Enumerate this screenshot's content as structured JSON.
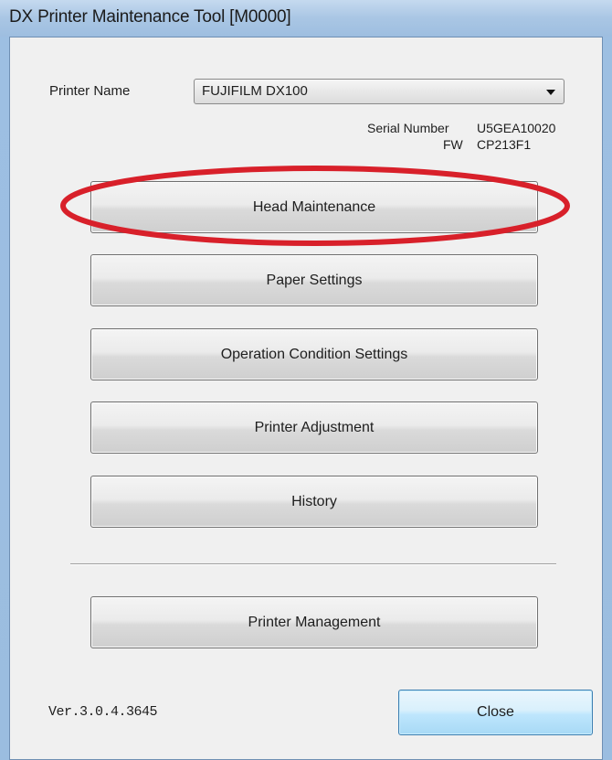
{
  "window": {
    "title": "DX Printer Maintenance Tool [M0000]"
  },
  "printer": {
    "name_label": "Printer Name",
    "selected": "FUJIFILM DX100",
    "serial_label": "Serial Number",
    "serial_value": "U5GEA10020",
    "fw_label": "FW",
    "fw_value": "CP213F1"
  },
  "buttons": {
    "head_maintenance": "Head Maintenance",
    "paper_settings": "Paper Settings",
    "operation_condition_settings": "Operation Condition Settings",
    "printer_adjustment": "Printer Adjustment",
    "history": "History",
    "printer_management": "Printer Management",
    "close": "Close"
  },
  "footer": {
    "version": "Ver.3.0.4.3645"
  },
  "colors": {
    "highlight_ellipse": "#d8202a",
    "title_bar": "#a9c6e4",
    "client_background": "#f0f0f0",
    "close_button": "#bee6fd"
  }
}
